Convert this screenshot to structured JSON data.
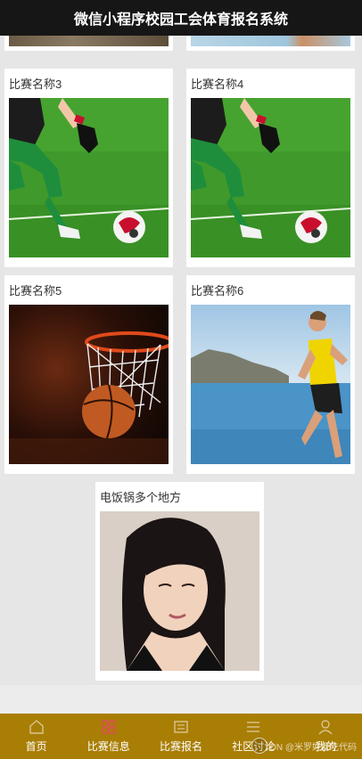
{
  "header": {
    "title": "微信小程序校园工会体育报名系统"
  },
  "competitions": [
    {
      "name": "比赛名称3",
      "image": "soccer-image"
    },
    {
      "name": "比赛名称4",
      "image": "soccer-image"
    },
    {
      "name": "比赛名称5",
      "image": "basketball-image"
    },
    {
      "name": "比赛名称6",
      "image": "runner-image"
    },
    {
      "name": "电饭锅多个地方",
      "image": "portrait-image"
    }
  ],
  "tabbar": {
    "items": [
      {
        "label": "首页",
        "icon": "home-icon"
      },
      {
        "label": "比赛信息",
        "icon": "grid-icon"
      },
      {
        "label": "比赛报名",
        "icon": "form-icon"
      },
      {
        "label": "社区讨论",
        "icon": "list-icon"
      },
      {
        "label": "我的",
        "icon": "user-icon"
      }
    ],
    "active_index": 1,
    "watermark": "DN @米罗好爱吃代码"
  },
  "colors": {
    "header_bg": "#161616",
    "tabbar_bg": "#a97e04",
    "active_icon": "#d9534f",
    "page_bg": "#e6e6e6"
  }
}
